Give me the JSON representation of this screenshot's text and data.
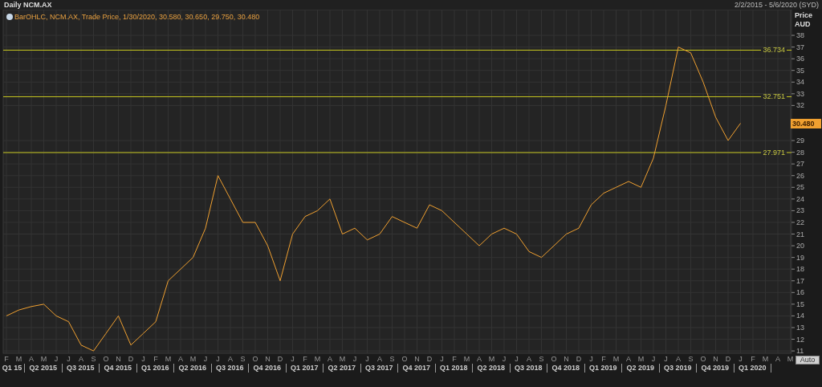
{
  "header": {
    "title": "Daily NCM.AX",
    "date_range": "2/2/2015 - 5/6/2020 (SYD)"
  },
  "legend": "BarOHLC, NCM.AX, Trade Price, 1/30/2020, 30.580, 30.650, 29.750, 30.480",
  "axis": {
    "title": "Price",
    "unit": "AUD",
    "last_price": "30.480",
    "auto_button": "Auto"
  },
  "chart_data": {
    "type": "line",
    "categories": [
      "F",
      "M",
      "A",
      "M",
      "J",
      "J",
      "A",
      "S",
      "O",
      "N",
      "D",
      "J",
      "F",
      "M",
      "A",
      "M",
      "J",
      "J",
      "A",
      "S",
      "O",
      "N",
      "D",
      "J",
      "F",
      "M",
      "A",
      "M",
      "J",
      "J",
      "A",
      "S",
      "O",
      "N",
      "D",
      "J",
      "F",
      "M",
      "A",
      "M",
      "J",
      "J",
      "A",
      "S",
      "O",
      "N",
      "D",
      "J",
      "F",
      "M",
      "A",
      "M",
      "J",
      "J",
      "A",
      "S",
      "O",
      "N",
      "D",
      "J",
      "F",
      "M",
      "A",
      "M"
    ],
    "grid": true,
    "series": [
      {
        "color": "#f0a030",
        "values": [
          14,
          14.5,
          14.8,
          15,
          14,
          13.5,
          11.5,
          11,
          12.5,
          14,
          11.5,
          12.5,
          13.5,
          17,
          18,
          19,
          21.5,
          26,
          24,
          22,
          22,
          20,
          17,
          21,
          22.5,
          23,
          24,
          21,
          21.5,
          20.5,
          21,
          22.5,
          22,
          21.5,
          23.5,
          23,
          22,
          21,
          20,
          21,
          21.5,
          21,
          19.5,
          19,
          20,
          21,
          21.5,
          23.5,
          24.5,
          25,
          25.5,
          25,
          27.5,
          32,
          37,
          36.5,
          34,
          31,
          29,
          30.48,
          null,
          null,
          null,
          null
        ]
      }
    ],
    "ylim": [
      10.8,
      40.2
    ],
    "yticks": [
      11,
      12,
      13,
      14,
      15,
      16,
      17,
      18,
      19,
      20,
      21,
      22,
      23,
      24,
      25,
      26,
      27,
      28,
      29,
      32,
      33,
      34,
      35,
      36,
      37,
      38
    ],
    "ref_lines": [
      {
        "axis": "y",
        "value": 36.734,
        "label": "36.734"
      },
      {
        "axis": "y",
        "value": 32.751,
        "label": "32.751"
      },
      {
        "axis": "y",
        "value": 27.971,
        "label": "27.971"
      }
    ]
  },
  "quarters": [
    "Q1 15",
    "Q2 2015",
    "Q3 2015",
    "Q4 2015",
    "Q1 2016",
    "Q2 2016",
    "Q3 2016",
    "Q4 2016",
    "Q1 2017",
    "Q2 2017",
    "Q3 2017",
    "Q4 2017",
    "Q1 2018",
    "Q2 2018",
    "Q3 2018",
    "Q4 2018",
    "Q1 2019",
    "Q2 2019",
    "Q3 2019",
    "Q4 2019",
    "Q1 2020"
  ]
}
